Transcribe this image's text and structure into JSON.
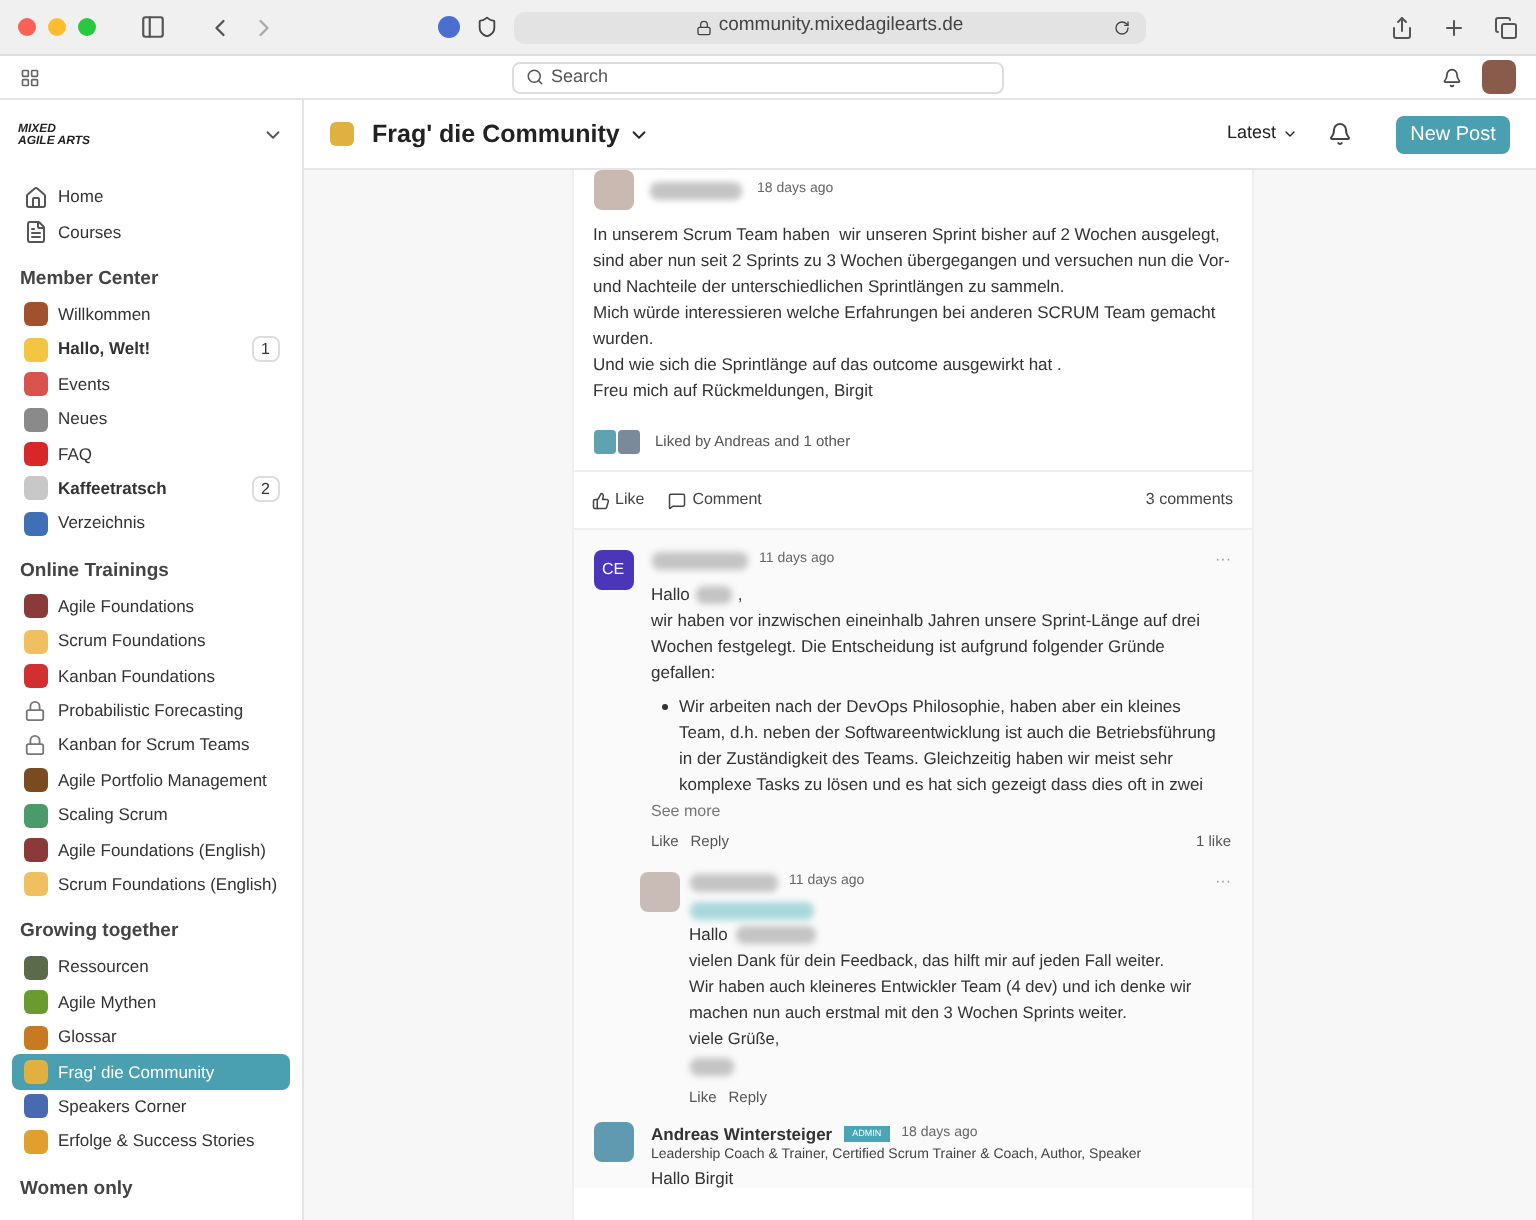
{
  "browser": {
    "url": "community.mixedagilearts.de"
  },
  "app_header": {
    "search_placeholder": "Search"
  },
  "sidebar": {
    "logo": [
      "MIXED",
      "AGILE ARTS"
    ],
    "items": [
      {
        "kind": "home",
        "label": "Home",
        "selected": false
      },
      {
        "kind": "courses",
        "label": "Courses",
        "selected": false
      }
    ],
    "sections": [
      {
        "title": "Member Center",
        "items": [
          {
            "kind": "emoji",
            "label": "Willkommen",
            "selected": false,
            "bold": false,
            "color": "#a0522d"
          },
          {
            "kind": "emoji",
            "label": "Hallo, Welt!",
            "selected": false,
            "bold": true,
            "count": "1",
            "color": "#f4c542"
          },
          {
            "kind": "emoji",
            "label": "Events",
            "selected": false,
            "bold": false,
            "color": "#d9534f"
          },
          {
            "kind": "emoji",
            "label": "Neues",
            "selected": false,
            "bold": false,
            "color": "#8a8a8a"
          },
          {
            "kind": "emoji",
            "label": "FAQ",
            "selected": false,
            "bold": false,
            "color": "#d62828"
          },
          {
            "kind": "emoji",
            "label": "Kaffeetratsch",
            "selected": false,
            "bold": true,
            "count": "2",
            "color": "#c8c8c8"
          },
          {
            "kind": "emoji",
            "label": "Verzeichnis",
            "selected": false,
            "bold": false,
            "color": "#3f6fb5"
          }
        ]
      },
      {
        "title": "Online Trainings",
        "items": [
          {
            "kind": "emoji",
            "label": "Agile Foundations",
            "selected": false,
            "bold": false,
            "color": "#8b3a3a"
          },
          {
            "kind": "emoji",
            "label": "Scrum Foundations",
            "selected": false,
            "bold": false,
            "color": "#f0c060"
          },
          {
            "kind": "emoji",
            "label": "Kanban Foundations",
            "selected": false,
            "bold": false,
            "color": "#d03030"
          },
          {
            "kind": "lock",
            "label": "Probabilistic Forecasting",
            "selected": false,
            "bold": false
          },
          {
            "kind": "lock",
            "label": "Kanban for Scrum Teams",
            "selected": false,
            "bold": false
          },
          {
            "kind": "emoji",
            "label": "Agile Portfolio Management",
            "selected": false,
            "bold": false,
            "color": "#7a4a20"
          },
          {
            "kind": "emoji",
            "label": "Scaling Scrum",
            "selected": false,
            "bold": false,
            "color": "#4a9a6a"
          },
          {
            "kind": "emoji",
            "label": "Agile Foundations (English)",
            "selected": false,
            "bold": false,
            "color": "#8b3a3a"
          },
          {
            "kind": "emoji",
            "label": "Scrum Foundations (English)",
            "selected": false,
            "bold": false,
            "color": "#f0c060"
          }
        ]
      },
      {
        "title": "Growing together",
        "items": [
          {
            "kind": "emoji",
            "label": "Ressourcen",
            "selected": false,
            "bold": false,
            "color": "#5a6a4a"
          },
          {
            "kind": "emoji",
            "label": "Agile Mythen",
            "selected": false,
            "bold": false,
            "color": "#6a9a30"
          },
          {
            "kind": "emoji",
            "label": "Glossar",
            "selected": false,
            "bold": false,
            "color": "#c87a20"
          },
          {
            "kind": "emoji",
            "label": "Frag' die Community",
            "selected": true,
            "bold": false,
            "color": "#e0b040"
          },
          {
            "kind": "emoji",
            "label": "Speakers Corner",
            "selected": false,
            "bold": false,
            "color": "#4a6ab0"
          },
          {
            "kind": "emoji",
            "label": "Erfolge & Success Stories",
            "selected": false,
            "bold": false,
            "color": "#e0a030"
          }
        ]
      },
      {
        "title": "Women only"
      }
    ]
  },
  "space_header": {
    "title": "Frag' die Community",
    "sort": "Latest",
    "new_post": "New Post"
  },
  "post": {
    "time": "18 days ago",
    "paragraphs": [
      "In unserem Scrum Team haben  wir unseren Sprint bisher auf 2 Wochen ausgelegt, sind aber nun seit 2 Sprints zu 3 Wochen übergegangen und versuchen nun die Vor- und Nachteile der unterschiedlichen Sprintlängen zu sammeln.",
      "Mich würde interessieren welche Erfahrungen bei anderen SCRUM Team gemacht wurden.",
      "Und wie sich die Sprintlänge auf das outcome ausgewirkt hat .",
      "Freu mich auf Rückmeldungen, Birgit"
    ],
    "liked_by": "Liked by Andreas and 1 other",
    "like": "Like",
    "comment": "Comment",
    "comments_count": "3 comments"
  },
  "comments": [
    {
      "initials": "CE",
      "time": "11 days ago",
      "more": "···",
      "greeting": "Hallo",
      "greeting_end": ",",
      "paragraphs": [
        "wir haben vor inzwischen eineinhalb Jahren unsere Sprint-Länge auf drei Wochen festgelegt. Die Entscheidung ist aufgrund folgender Gründe gefallen:"
      ],
      "bullets": [
        "Wir arbeiten nach der DevOps Philosophie, haben aber ein kleines Team, d.h. neben der Softwareentwicklung ist auch die Betriebsführung in der Zuständigkeit des Teams. Gleichzeitig haben wir meist sehr komplexe Tasks zu lösen und es hat sich gezeigt dass dies oft in zwei"
      ],
      "see_more": "See more",
      "like": "Like",
      "reply": "Reply",
      "likes": "1 like",
      "replies": [
        {
          "time": "11 days ago",
          "more": "···",
          "greeting": "Hallo",
          "paragraphs": [
            "vielen Dank für dein Feedback, das hilft mir auf jeden Fall weiter.",
            "Wir haben auch kleineres Entwickler Team (4 dev) und ich denke wir machen nun auch erstmal mit den 3 Wochen Sprints weiter.",
            "viele Grüße,"
          ],
          "like": "Like",
          "reply": "Reply"
        }
      ]
    },
    {
      "name": "Andreas Wintersteiger",
      "badge": "ADMIN",
      "time": "18 days ago",
      "headline": "Leadership Coach & Trainer, Certified Scrum Trainer & Coach, Author, Speaker",
      "paragraphs": [
        "Hallo Birgit"
      ]
    }
  ]
}
